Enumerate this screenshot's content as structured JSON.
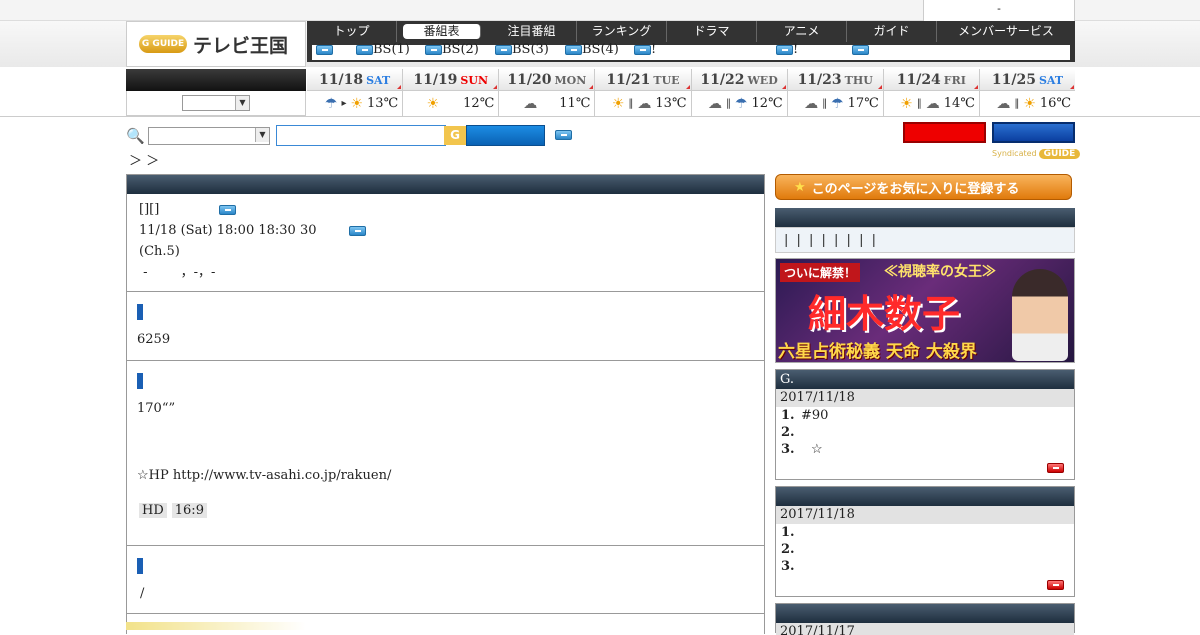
{
  "top": {
    "member_text": "-"
  },
  "header": {
    "logo_badge": "G GUIDE",
    "logo_text": "テレビ王国",
    "nav": [
      "トップ",
      "番組表",
      "注目番組",
      "ランキング",
      "ドラマ",
      "アニメ",
      "ガイド",
      "メンバーサービス"
    ],
    "subnav": [
      "",
      "BS(1)",
      "BS(2)",
      "BS(3)",
      "BS(4)",
      "!",
      "!",
      ""
    ]
  },
  "days": [
    {
      "date": "11/18",
      "dow": "SAT",
      "weather": "rain>sun",
      "temp": "13℃"
    },
    {
      "date": "11/19",
      "dow": "SUN",
      "weather": "sun",
      "temp": "12℃"
    },
    {
      "date": "11/20",
      "dow": "MON",
      "weather": "cloud",
      "temp": "11℃"
    },
    {
      "date": "11/21",
      "dow": "TUE",
      "weather": "sun|cloud",
      "temp": "13℃"
    },
    {
      "date": "11/22",
      "dow": "WED",
      "weather": "cloud|rain",
      "temp": "12℃"
    },
    {
      "date": "11/23",
      "dow": "THU",
      "weather": "cloud|rain",
      "temp": "17℃"
    },
    {
      "date": "11/24",
      "dow": "FRI",
      "weather": "sun|cloud",
      "temp": "14℃"
    },
    {
      "date": "11/25",
      "dow": "SAT",
      "weather": "cloud|sun",
      "temp": "16℃"
    }
  ],
  "search": {
    "g": "G",
    "breadcrumb": "＞ ＞",
    "synd": "Syndicated",
    "synd_badge": "GUIDE"
  },
  "program": {
    "title": "[][]",
    "time": "11/18 (Sat) 18:00  18:30 30",
    "channel": "(Ch.5)",
    "cast": " -        ，-，-",
    "s2_text": "6259",
    "s3_text": "170“”",
    "hp": "☆HP  http://www.tv-asahi.co.jp/rakuen/",
    "tags": [
      "HD",
      "16:9",
      ""
    ],
    "s4_text": "/"
  },
  "sidebar": {
    "fav_label": "このページをお気に入りに登録する",
    "links": "| | | | | | | |",
    "ad": {
      "l1": "ついに解禁！",
      "l2": "≪視聴率の女王≫",
      "l3": "細木数子",
      "l4": "六星占術秘義 天命 大殺界"
    },
    "rank1": {
      "title": "G.",
      "date": "2017/11/18",
      "items": [
        [
          "1.",
          "#90"
        ],
        [
          "2.",
          ""
        ],
        [
          "3.",
          "☆"
        ]
      ]
    },
    "rank2": {
      "title": "",
      "date": "2017/11/18",
      "items": [
        [
          "1.",
          ""
        ],
        [
          "2.",
          ""
        ],
        [
          "3.",
          ""
        ]
      ]
    },
    "rank3": {
      "date": "2017/11/17"
    }
  }
}
